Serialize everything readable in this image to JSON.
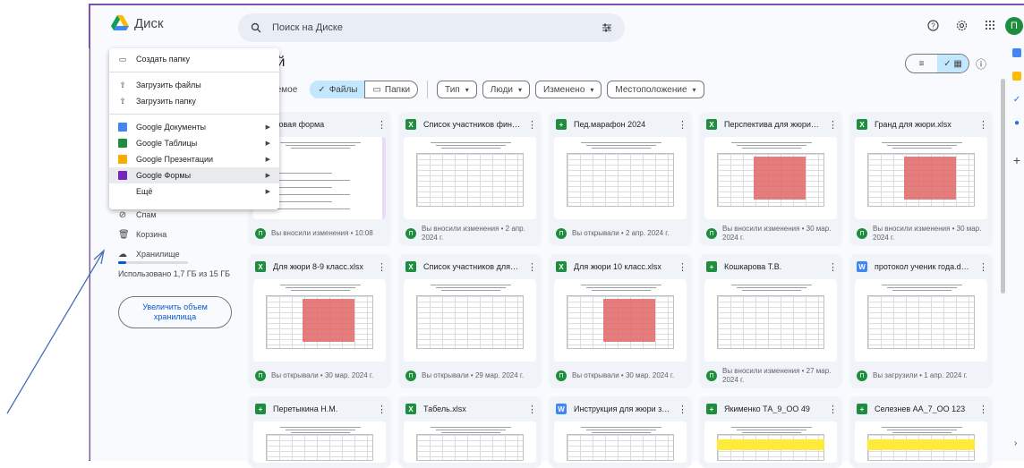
{
  "app": {
    "title": "Диск"
  },
  "search": {
    "placeholder": "Поиск на Диске"
  },
  "header": {
    "title_partial": "ый",
    "avatar_letter": "П"
  },
  "filters": {
    "suggested_partial": "дуемое",
    "files": "Файлы",
    "folders": "Папки",
    "type": "Тип",
    "people": "Люди",
    "modified": "Изменено",
    "location": "Местоположение"
  },
  "new_menu": {
    "items": [
      {
        "label": "Создать папку"
      },
      {
        "label": "Загрузить файлы"
      },
      {
        "label": "Загрузить папку"
      },
      {
        "label": "Google Документы"
      },
      {
        "label": "Google Таблицы"
      },
      {
        "label": "Google Презентации"
      },
      {
        "label": "Google Формы"
      },
      {
        "label": "Ещё"
      }
    ]
  },
  "sidebar": {
    "items": [
      {
        "label": "Спам"
      },
      {
        "label": "Корзина"
      },
      {
        "label": "Хранилище"
      }
    ],
    "storage_text": "Использовано 1,7 ГБ из 15 ГБ",
    "storage_fraction": 0.11,
    "upgrade_label": "Увеличить объем хранилища"
  },
  "files": [
    {
      "name": "Новая форма",
      "type": "form",
      "meta": "Вы вносили изменения • 10:08"
    },
    {
      "name": "Список участников финал...",
      "type": "xlsx",
      "meta": "Вы вносили изменения • 2 апр. 2024 г."
    },
    {
      "name": "Пед.марафон 2024",
      "type": "sheet",
      "meta": "Вы открывали • 2 апр. 2024 г."
    },
    {
      "name": "Перспектива для жюри.xlsx",
      "type": "xlsx",
      "meta": "Вы вносили изменения • 30 мар. 2024 г."
    },
    {
      "name": "Гранд для жюри.xlsx",
      "type": "xlsx",
      "meta": "Вы вносили изменения • 30 мар. 2024 г."
    },
    {
      "name": "Для жюри 8-9 класс.xlsx",
      "type": "xlsx",
      "meta": "Вы открывали • 30 мар. 2024 г."
    },
    {
      "name": "Список участников для ж...",
      "type": "xlsx",
      "meta": "Вы открывали • 29 мар. 2024 г."
    },
    {
      "name": "Для жюри 10 класс.xlsx",
      "type": "xlsx",
      "meta": "Вы открывали • 30 мар. 2024 г."
    },
    {
      "name": "Кошкарова Т.В.",
      "type": "sheet",
      "meta": "Вы вносили изменения • 27 мар. 2024 г."
    },
    {
      "name": "протокол ученик года.docx",
      "type": "doc",
      "meta": "Вы загрузили • 1 апр. 2024 г."
    },
    {
      "name": "Перетыкина Н.М.",
      "type": "sheet",
      "meta": ""
    },
    {
      "name": "Табель.xlsx",
      "type": "xlsx",
      "meta": ""
    },
    {
      "name": "Инструкция для жюри зао...",
      "type": "doc",
      "meta": ""
    },
    {
      "name": "Якименко ТА_9_ОО 49",
      "type": "sheet",
      "meta": ""
    },
    {
      "name": "Селезнев АА_7_ОО 123",
      "type": "sheet",
      "meta": ""
    }
  ]
}
